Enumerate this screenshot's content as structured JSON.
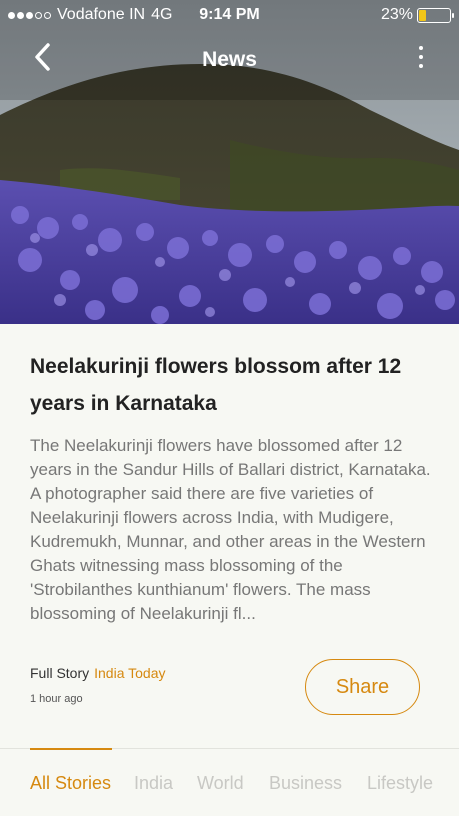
{
  "status_bar": {
    "carrier": "Vodafone IN",
    "network": "4G",
    "time": "9:14 PM",
    "battery_percent": "23%",
    "battery_level": 0.23,
    "signal_filled": 3,
    "signal_total": 5
  },
  "nav": {
    "title": "News",
    "back_icon": "chevron-left-icon",
    "more_icon": "more-vertical-icon"
  },
  "article": {
    "headline": "Neelakurinji flowers blossom after 12 years in Karnataka",
    "body": "The Neelakurinji flowers have blossomed after 12 years in the Sandur Hills of Ballari district, Karnataka. A photographer said there are five varieties of Neelakurinji flowers across India, with Mudigere, Kudremukh, Munnar, and other areas in the Western Ghats witnessing mass blossoming of the 'Strobilanthes kunthianum' flowers. The mass blossoming of Neelakurinji fl...",
    "full_story_label": "Full Story",
    "source": "India Today",
    "time_ago": "1 hour ago",
    "share_label": "Share"
  },
  "tabs": [
    {
      "label": "All Stories",
      "active": true
    },
    {
      "label": "India",
      "active": false
    },
    {
      "label": "World",
      "active": false
    },
    {
      "label": "Business",
      "active": false
    },
    {
      "label": "Lifestyle",
      "active": false
    }
  ],
  "colors": {
    "accent": "#d68910",
    "background": "#f7f8f3"
  }
}
